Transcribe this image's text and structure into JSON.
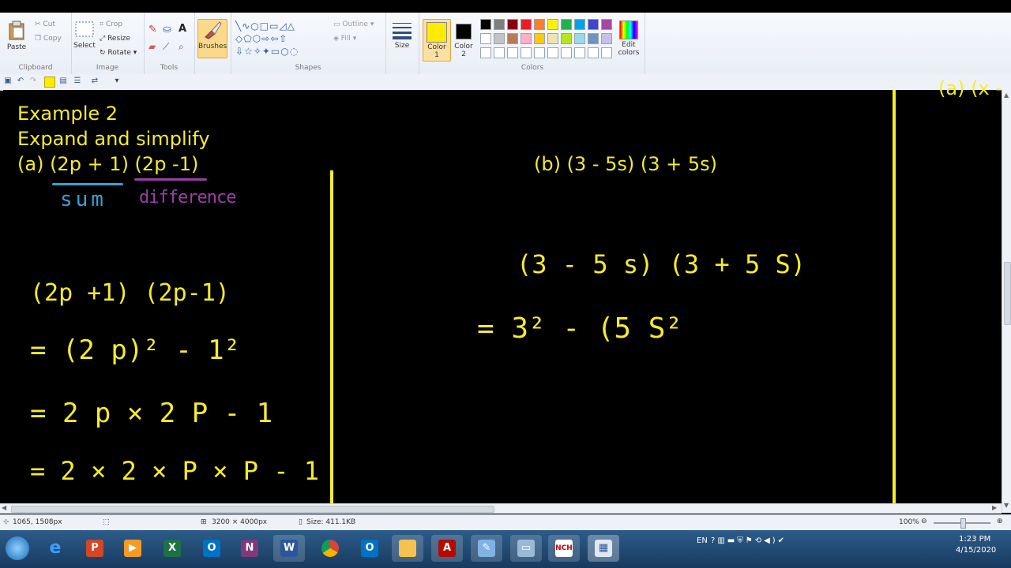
{
  "ribbon": {
    "clipboard": {
      "label": "Clipboard",
      "paste": "Paste",
      "cut": "Cut",
      "copy": "Copy"
    },
    "image": {
      "label": "Image",
      "select": "Select",
      "crop": "Crop",
      "resize": "Resize",
      "rotate": "Rotate"
    },
    "tools": {
      "label": "Tools"
    },
    "brushes": {
      "label": "Brushes"
    },
    "shapes": {
      "label": "Shapes",
      "outline": "Outline",
      "fill": "Fill"
    },
    "size": {
      "label": "Size"
    },
    "color1": {
      "label": "Color",
      "num": "1",
      "value": "#ffeb00"
    },
    "color2": {
      "label": "Color",
      "num": "2",
      "value": "#000000"
    },
    "colors": {
      "label": "Colors",
      "edit_line1": "Edit",
      "edit_line2": "colors"
    },
    "palette_row1": [
      "#000000",
      "#7f7f7f",
      "#880015",
      "#ed1c24",
      "#ff7f27",
      "#fff200",
      "#22b14c",
      "#00a2e8",
      "#3f48cc",
      "#a349a4"
    ],
    "palette_row2": [
      "#ffffff",
      "#c3c3c3",
      "#b97a57",
      "#ffaec9",
      "#ffc90e",
      "#efe4b0",
      "#b5e61d",
      "#99d9ea",
      "#7092be",
      "#c8bfe7"
    ]
  },
  "canvas": {
    "title1": "Example 2",
    "title2": "Expand and simplify",
    "part_a": "(a) (2p + 1) (2p -1)",
    "part_b": "(b) (3 - 5s) (3 + 5s)",
    "note_sum": "sum",
    "note_difference": "difference",
    "line_a1": "(2p +1) (2p-1)",
    "line_a2": "= (2 p)² - 1²",
    "line_a3": "= 2 p × 2 P - 1",
    "line_a4": "= 2 × 2 × P × P - 1",
    "line_b1": "(3 - 5 s) (3 + 5 S)",
    "line_b2": "= 3² - (5 S²",
    "cut_text": "(a) (x -",
    "colors": {
      "ink": "#f5ec2a",
      "sum": "#3aa0d8",
      "difference": "#9b3fa8"
    }
  },
  "status": {
    "cursor": "1065, 1508px",
    "dimensions": "3200 × 4000px",
    "size": "Size: 411.1KB",
    "zoom": "100%"
  },
  "taskbar": {
    "apps": [
      "start-orb",
      "internet-explorer",
      "powerpoint",
      "media",
      "excel",
      "outlook",
      "onenote",
      "word",
      "chrome",
      "outlook-2",
      "explorer",
      "acrobat",
      "paint-brush",
      "window",
      "nch",
      "paint"
    ],
    "lang": "EN",
    "time": "1:23 PM",
    "date": "4/15/2020"
  }
}
